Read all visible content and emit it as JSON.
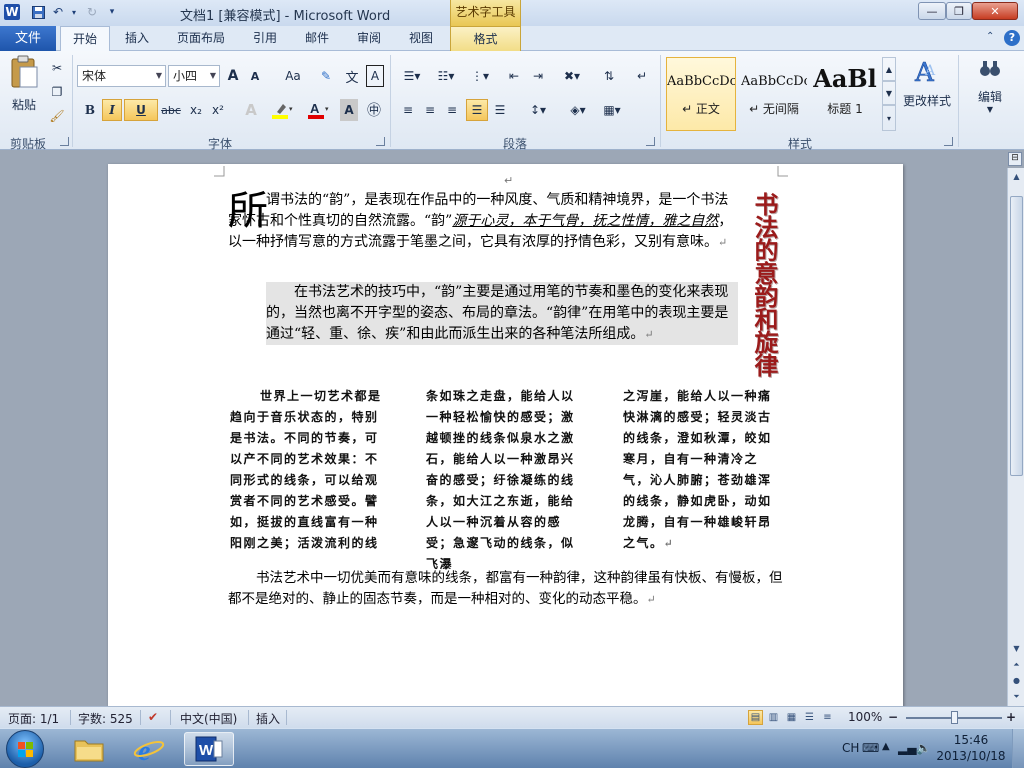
{
  "titlebar": {
    "logo": "W",
    "title": "文档1 [兼容模式] - Microsoft Word",
    "context_group": "艺术字工具",
    "minimize": "—",
    "maximize": "❐",
    "close": "✕"
  },
  "tabs": {
    "file": "文件",
    "items": [
      "开始",
      "插入",
      "页面布局",
      "引用",
      "邮件",
      "审阅",
      "视图"
    ],
    "format": "格式"
  },
  "clipboard": {
    "paste": "粘贴",
    "label": "剪贴板"
  },
  "font": {
    "name": "宋体",
    "size": "小四",
    "grow": "A",
    "shrink": "A",
    "change_case": "Aa",
    "bold": "B",
    "italic": "I",
    "underline": "U",
    "strike": "abc",
    "subscript": "x₂",
    "superscript": "x²",
    "label": "字体"
  },
  "paragraph": {
    "label": "段落"
  },
  "styles": {
    "items": [
      {
        "sample": "AaBbCcDc",
        "name": "↵ 正文"
      },
      {
        "sample": "AaBbCcDc",
        "name": "↵ 无间隔"
      },
      {
        "sample": "AaBl",
        "name": "标题 1"
      }
    ],
    "change_styles": "更改样式",
    "label": "样式"
  },
  "editing": {
    "label": "编辑"
  },
  "document": {
    "drop_cap": "所",
    "para1_a": "谓书法的“韵”，是表现在作品中的一种风度、气质和精神境界，是一个书法家怀古和个性真切的自然流露。“韵”",
    "para1_b": "源于心灵，本于气骨，",
    "para1_c": "抚之性情，雅之自然",
    "para1_d": "，以一种抒情写意的方式流露于笔墨之间，它具有浓厚的抒情色彩，又别有意味。",
    "para2": "在书法艺术的技巧中，“韵”主要是通过用笔的节奏和墨色的变化来表现的，当然也离不开字型的姿态、布局的章法。“韵律”在用笔中的表现主要是通过“轻、重、徐、疾”和由此而派生出来的各种笔法所组成。",
    "art_title": "书法的意韵和旋律",
    "col1": "世界上一切艺术都是趋向于音乐状态的，特别是书法。不同的节奏，可以产不同的艺术效果：不同形式的线条，可以给观赏者不同的艺术感受。譬如，挺拔的直线富有一种阳刚之美；活泼流利的线",
    "col2": "条如珠之走盘，能给人以一种轻松愉快的感受；激越顿挫的线条似泉水之激石，能给人以一种激昂兴奋的感受；纡徐凝练的线条，如大江之东逝，能给人以一种沉着从容的感受；急邃飞动的线条，似飞瀑",
    "col3": "之泻崖，能给人以一种痛快淋漓的感受；轻灵淡古的线条，澄如秋潭，皎如寒月，自有一种清冷之气，沁人肺腑；苍劲雄浑的线条，静如虎卧，动如龙腾，自有一种雄峻轩昂之气。",
    "para3": "书法艺术中一切优美而有意味的线条，都富有一种韵律，这种韵律虽有快板、有慢板，但都不是绝对的、静止的固态节奏，而是一种相对的、变化的动态平稳。",
    "para_mark": "↵"
  },
  "statusbar": {
    "page": "页面: 1/1",
    "word_count": "字数: 525",
    "language": "中文(中国)",
    "mode": "插入",
    "zoom": "100%",
    "zoom_out": "−",
    "zoom_in": "+"
  },
  "taskbar": {
    "ime": "CH",
    "time": "15:46",
    "date": "2013/10/18"
  },
  "colors": {
    "accent": "#1e55ab",
    "art_text": "#9b1b1b",
    "highlight_button": "#f5c65b"
  }
}
